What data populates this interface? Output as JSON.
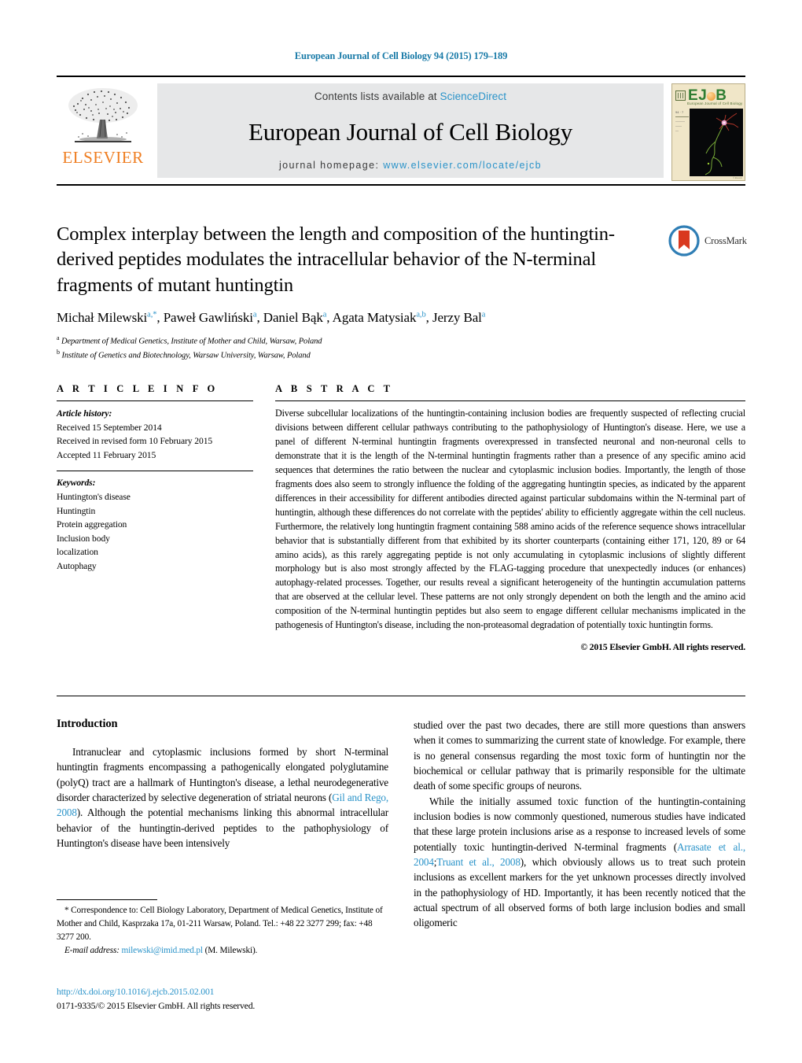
{
  "running_head": "European Journal of Cell Biology 94 (2015) 179–189",
  "masthead": {
    "publisher_name": "ELSEVIER",
    "contents_prefix": "Contents lists available at ",
    "contents_link": "ScienceDirect",
    "journal_title": "European Journal of Cell Biology",
    "homepage_prefix": "journal homepage: ",
    "homepage_url": "www.elsevier.com/locate/ejcb",
    "cover": {
      "acronym_e": "E",
      "acronym_j": "J",
      "acronym_c": "C",
      "acronym_b": "B",
      "subtitle": "European Journal of Cell Biology",
      "volume_meta": "94\n2015",
      "credit": "© Elsevier"
    }
  },
  "crossmark": {
    "label": "CrossMark"
  },
  "article": {
    "title": "Complex interplay between the length and composition of the huntingtin-derived peptides modulates the intracellular behavior of the N-terminal fragments of mutant huntingtin",
    "authors": [
      {
        "name": "Michał Milewski",
        "sup": "a,*"
      },
      {
        "name": "Paweł Gawliński",
        "sup": "a"
      },
      {
        "name": "Daniel Bąk",
        "sup": "a"
      },
      {
        "name": "Agata Matysiak",
        "sup": "a,b"
      },
      {
        "name": "Jerzy Bal",
        "sup": "a"
      }
    ],
    "affiliations": [
      {
        "marker": "a",
        "text": "Department of Medical Genetics, Institute of Mother and Child, Warsaw, Poland"
      },
      {
        "marker": "b",
        "text": "Institute of Genetics and Biotechnology, Warsaw University, Warsaw, Poland"
      }
    ]
  },
  "article_info": {
    "heading": "A R T I C L E   I N F O",
    "history_label": "Article history:",
    "history": [
      "Received 15 September 2014",
      "Received in revised form 10 February 2015",
      "Accepted 11 February 2015"
    ],
    "keywords_label": "Keywords:",
    "keywords": [
      "Huntington's disease",
      "Huntingtin",
      "Protein aggregation",
      "Inclusion body",
      "localization",
      "Autophagy"
    ]
  },
  "abstract": {
    "heading": "A B S T R A C T",
    "text": "Diverse subcellular localizations of the huntingtin-containing inclusion bodies are frequently suspected of reflecting crucial divisions between different cellular pathways contributing to the pathophysiology of Huntington's disease. Here, we use a panel of different N-terminal huntingtin fragments overexpressed in transfected neuronal and non-neuronal cells to demonstrate that it is the length of the N-terminal huntingtin fragments rather than a presence of any specific amino acid sequences that determines the ratio between the nuclear and cytoplasmic inclusion bodies. Importantly, the length of those fragments does also seem to strongly influence the folding of the aggregating huntingtin species, as indicated by the apparent differences in their accessibility for different antibodies directed against particular subdomains within the N-terminal part of huntingtin, although these differences do not correlate with the peptides' ability to efficiently aggregate within the cell nucleus. Furthermore, the relatively long huntingtin fragment containing 588 amino acids of the reference sequence shows intracellular behavior that is substantially different from that exhibited by its shorter counterparts (containing either 171, 120, 89 or 64 amino acids), as this rarely aggregating peptide is not only accumulating in cytoplasmic inclusions of slightly different morphology but is also most strongly affected by the FLAG-tagging procedure that unexpectedly induces (or enhances) autophagy-related processes. Together, our results reveal a significant heterogeneity of the huntingtin accumulation patterns that are observed at the cellular level. These patterns are not only strongly dependent on both the length and the amino acid composition of the N-terminal huntingtin peptides but also seem to engage different cellular mechanisms implicated in the pathogenesis of Huntington's disease, including the non-proteasomal degradation of potentially toxic huntingtin forms.",
    "copyright": "© 2015 Elsevier GmbH. All rights reserved."
  },
  "introduction": {
    "heading": "Introduction",
    "left_para_1_a": "Intranuclear and cytoplasmic inclusions formed by short N-terminal huntingtin fragments encompassing a pathogenically elongated polyglutamine (polyQ) tract are a hallmark of Huntington's disease, a lethal neurodegenerative disorder characterized by selective degeneration of striatal neurons (",
    "left_para_1_cite": "Gil and Rego, 2008",
    "left_para_1_b": "). Although the potential mechanisms linking this abnormal intracellular behavior of the huntingtin-derived peptides to the pathophysiology of Huntington's disease have been intensively",
    "right_para_1": "studied over the past two decades, there are still more questions than answers when it comes to summarizing the current state of knowledge. For example, there is no general consensus regarding the most toxic form of huntingtin nor the biochemical or cellular pathway that is primarily responsible for the ultimate death of some specific groups of neurons.",
    "right_para_2_a": "While the initially assumed toxic function of the huntingtin-containing inclusion bodies is now commonly questioned, numerous studies have indicated that these large protein inclusions arise as a response to increased levels of some potentially toxic huntingtin-derived N-terminal fragments (",
    "right_para_2_cite1": "Arrasate et al., 2004",
    "right_para_2_sep": ";",
    "right_para_2_cite2": "Truant et al., 2008",
    "right_para_2_b": "), which obviously allows us to treat such protein inclusions as excellent markers for the yet unknown processes directly involved in the pathophysiology of HD. Importantly, it has been recently noticed that the actual spectrum of all observed forms of both large inclusion bodies and small oligomeric"
  },
  "footnotes": {
    "correspondence": "* Correspondence to: Cell Biology Laboratory, Department of Medical Genetics, Institute of Mother and Child, Kasprzaka 17a, 01-211 Warsaw, Poland. Tel.: +48 22 3277 299; fax: +48 3277 200.",
    "email_label": "E-mail address:",
    "email_address": "milewski@imid.med.pl",
    "email_owner": "(M. Milewski).",
    "doi": "http://dx.doi.org/10.1016/j.ejcb.2015.02.001",
    "issn_line": "0171-9335/© 2015 Elsevier GmbH. All rights reserved."
  },
  "colors": {
    "link_blue": "#2a93c9",
    "running_head_blue": "#1a7ba8",
    "elsevier_orange": "#ef7d20",
    "band_gray": "#e6e7e8",
    "cover_cream": "#f0e6c8",
    "cover_green": "#2f7d32",
    "crossmark_red": "#d9391f",
    "crossmark_blue": "#2f7eb5"
  }
}
